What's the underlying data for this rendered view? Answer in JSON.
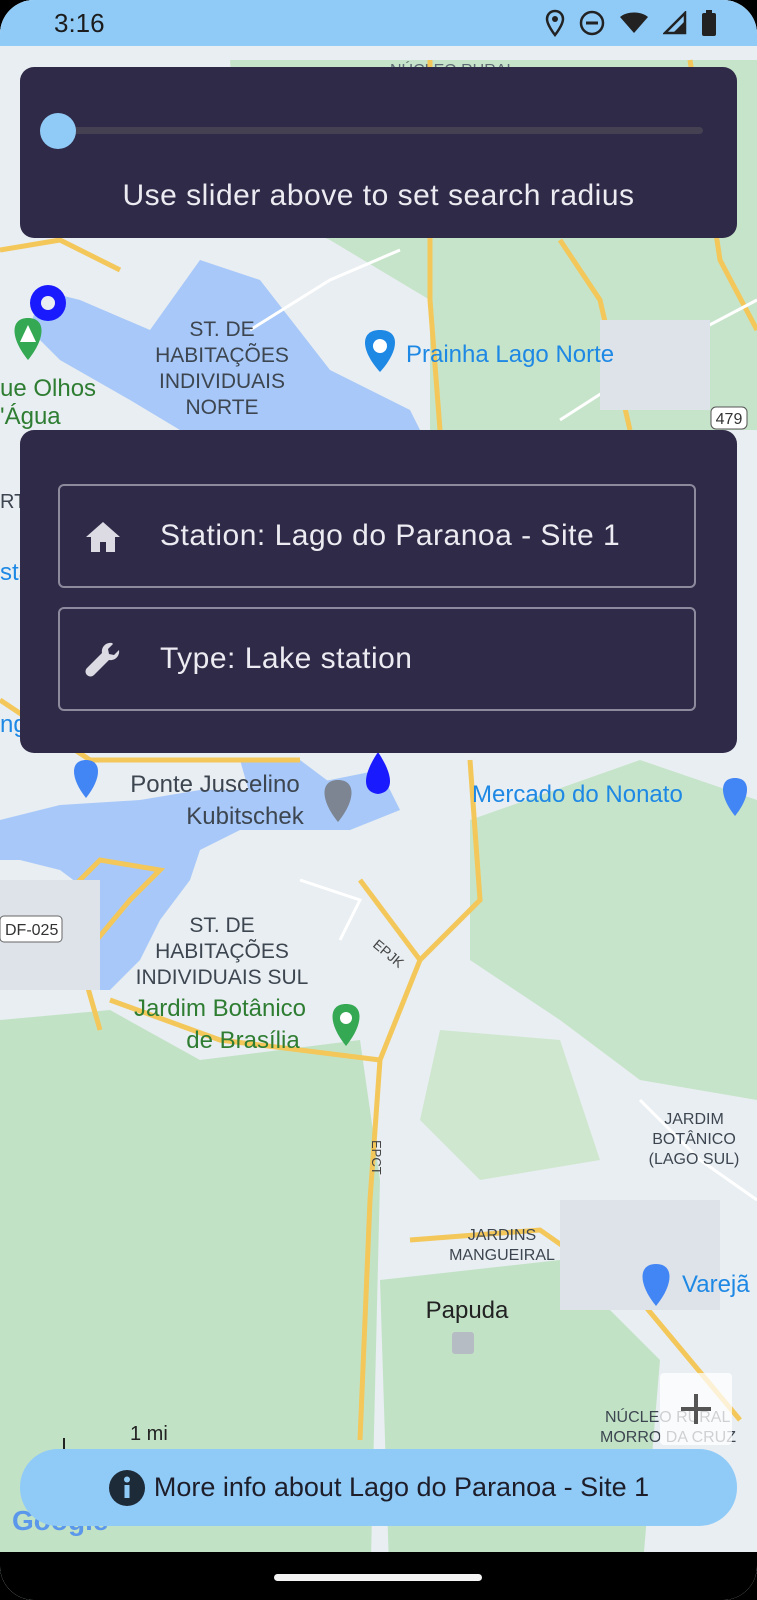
{
  "status_bar": {
    "time": "3:16"
  },
  "slider": {
    "caption": "Use slider above to set search radius",
    "value_fraction": 0.0
  },
  "station": {
    "name_label": "Station: Lago do Paranoa - Site 1",
    "type_label": "Type: Lake station"
  },
  "more_info": {
    "label": "More info about Lago do Paranoa - Site 1"
  },
  "map": {
    "labels": {
      "nucleo_rural": "NÚCLEO RURAL",
      "st_hab_norte_1": "ST. DE",
      "st_hab_norte_2": "HABITAÇÕES",
      "st_hab_norte_3": "INDIVIDUAIS",
      "st_hab_norte_4": "NORTE",
      "prainha": "Prainha Lago Norte",
      "route_479": "479",
      "olhos_1": "ue Olhos",
      "olhos_2": "'Água",
      "left_rt": "RT",
      "left_sta": "stá",
      "left_ng": "ng",
      "ponte_1": "Ponte Juscelino",
      "ponte_2": "Kubitschek",
      "mercado": "Mercado do Nonato",
      "df025": "DF-025",
      "epjk": "EPJK",
      "st_hab_sul_1": "ST. DE",
      "st_hab_sul_2": "HABITAÇÕES",
      "st_hab_sul_3": "INDIVIDUAIS SUL",
      "jardim_1": "Jardim Botânico",
      "jardim_2": "de Brasília",
      "jb_lago_1": "JARDIM",
      "jb_lago_2": "BOTÂNICO",
      "jb_lago_3": "(LAGO SUL)",
      "epct": "EPCT",
      "jardins_1": "JARDINS",
      "jardins_2": "MANGUEIRAL",
      "vareja": "Varejã",
      "papuda": "Papuda",
      "nucleo_morro_1": "NÚCLEO RURAL",
      "nucleo_morro_2": "MORRO DA CRUZ",
      "scale": "1 mi",
      "google": "Google"
    },
    "colors": {
      "land": "#e9eef2",
      "green": "#c2e2c6",
      "water": "#a7c8f8",
      "road": "#f3c75a"
    }
  }
}
